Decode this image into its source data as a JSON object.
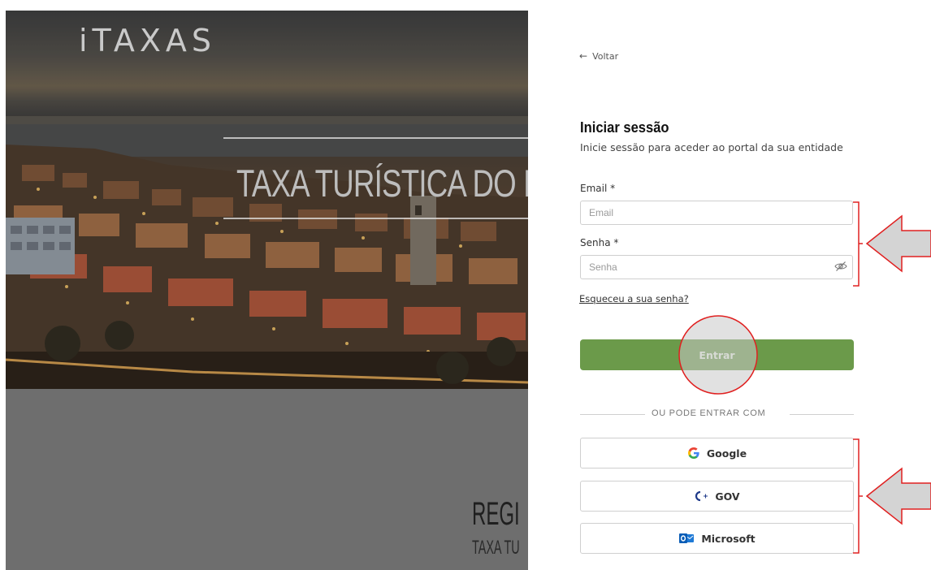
{
  "brand": {
    "logo_text": "iTAXAS"
  },
  "hero": {
    "title": "TAXA TURÍSTICA DO M",
    "lower_title": "REGI",
    "lower_subtitle": "TAXA TU"
  },
  "login": {
    "back_label": "Voltar",
    "title": "Iniciar sessão",
    "subtitle": "Inicie sessão para aceder ao portal da sua entidade",
    "email_label": "Email *",
    "email_placeholder": "Email",
    "password_label": "Senha *",
    "password_placeholder": "Senha",
    "forgot_label": "Esqueceu a sua senha?",
    "submit_label": "Entrar",
    "divider_label": "OU PODE ENTRAR COM",
    "providers": [
      {
        "label": "Google",
        "icon": "google-icon"
      },
      {
        "label": "GOV",
        "icon": "gov-icon"
      },
      {
        "label": "Microsoft",
        "icon": "outlook-icon"
      }
    ]
  },
  "colors": {
    "primary_button": "#6b9a4a",
    "annotation_red": "#e02020",
    "annotation_arrow_fill": "#d4d4d4"
  }
}
